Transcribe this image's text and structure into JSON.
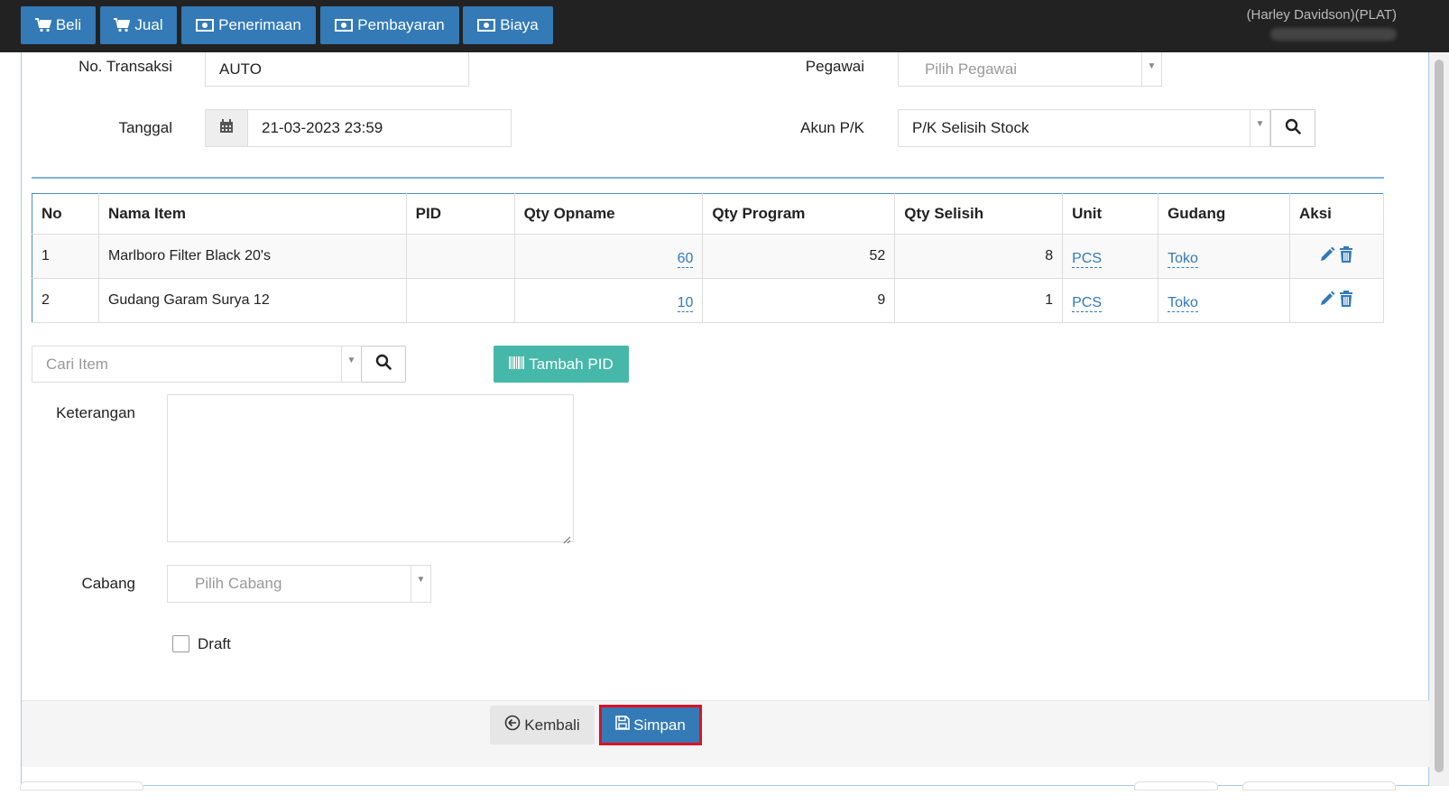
{
  "navbar": {
    "buttons": [
      {
        "label": "Beli",
        "icon": "cart-icon"
      },
      {
        "label": "Jual",
        "icon": "cart-icon"
      },
      {
        "label": "Penerimaan",
        "icon": "money-icon"
      },
      {
        "label": "Pembayaran",
        "icon": "money-icon"
      },
      {
        "label": "Biaya",
        "icon": "money-icon"
      }
    ],
    "company": "(Harley Davidson)(PLAT)"
  },
  "form": {
    "no_transaksi_label": "No. Transaksi",
    "no_transaksi_value": "AUTO",
    "tanggal_label": "Tanggal",
    "tanggal_value": "21-03-2023 23:59",
    "pegawai_label": "Pegawai",
    "pegawai_placeholder": "Pilih Pegawai",
    "akun_label": "Akun P/K",
    "akun_value": "P/K Selisih Stock"
  },
  "table": {
    "headers": [
      "No",
      "Nama Item",
      "PID",
      "Qty Opname",
      "Qty Program",
      "Qty Selisih",
      "Unit",
      "Gudang",
      "Aksi"
    ],
    "rows": [
      {
        "no": "1",
        "nama": "Marlboro Filter Black 20's",
        "pid": "",
        "qty_opname": "60",
        "qty_program": "52",
        "qty_selisih": "8",
        "unit": "PCS",
        "gudang": "Toko"
      },
      {
        "no": "2",
        "nama": "Gudang Garam Surya 12",
        "pid": "",
        "qty_opname": "10",
        "qty_program": "9",
        "qty_selisih": "1",
        "unit": "PCS",
        "gudang": "Toko"
      }
    ]
  },
  "search_item": {
    "placeholder": "Cari Item"
  },
  "tambah_pid_label": "Tambah PID",
  "keterangan_label": "Keterangan",
  "cabang_label": "Cabang",
  "cabang_placeholder": "Pilih Cabang",
  "draft_label": "Draft",
  "footer": {
    "kembali_label": "Kembali",
    "simpan_label": "Simpan"
  },
  "colors": {
    "primary": "#337ab7",
    "teal": "#46b8a9",
    "navbar": "#222222",
    "highlight": "#e01020"
  }
}
